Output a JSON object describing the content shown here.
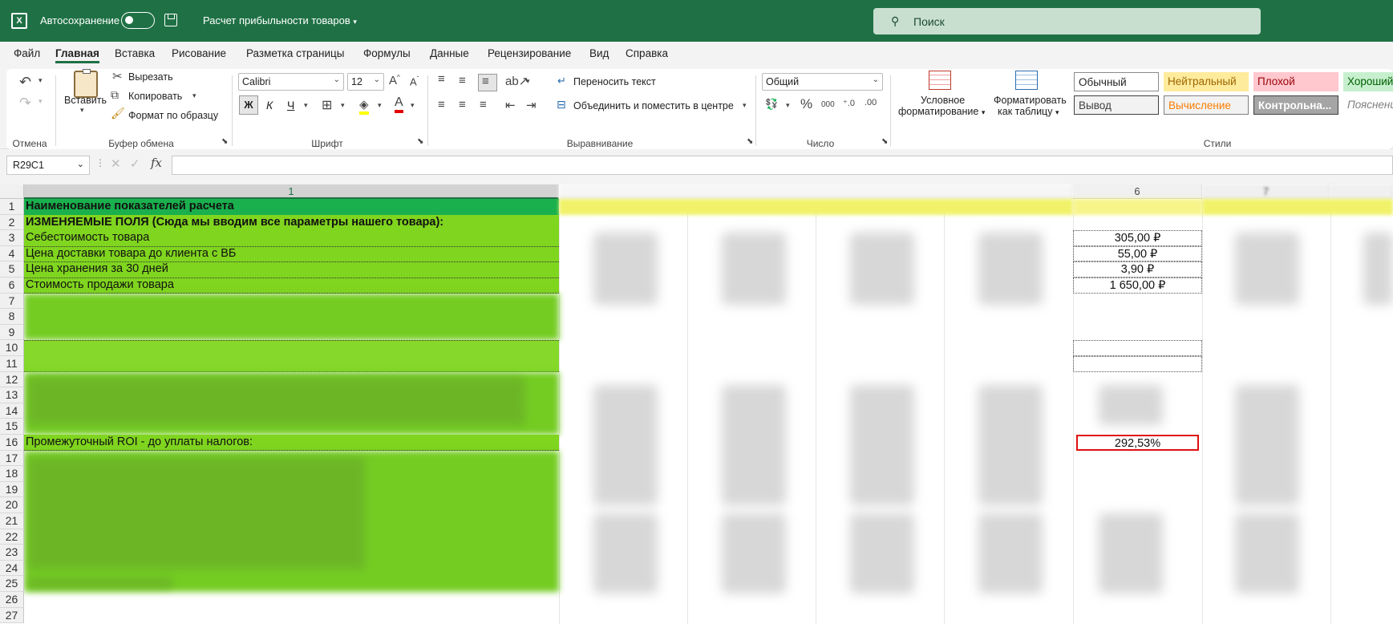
{
  "titlebar": {
    "autosave_label": "Автосохранение",
    "document_title": "Расчет прибыльности товаров",
    "search_placeholder": "Поиск"
  },
  "menu": [
    "Файл",
    "Главная",
    "Вставка",
    "Рисование",
    "Разметка страницы",
    "Формулы",
    "Данные",
    "Рецензирование",
    "Вид",
    "Справка"
  ],
  "ribbon": {
    "groups": {
      "undo": "Отмена",
      "clipboard": "Буфер обмена",
      "font": "Шрифт",
      "alignment": "Выравнивание",
      "number": "Число",
      "styles": "Стили"
    },
    "paste": "Вставить",
    "cut": "Вырезать",
    "copy": "Копировать",
    "format_painter": "Формат по образцу",
    "font_name": "Calibri",
    "font_size": "12",
    "bold": "Ж",
    "italic": "К",
    "underline": "Ч",
    "wrap_text": "Переносить текст",
    "merge_center": "Объединить и поместить в центре",
    "number_format": "Общий",
    "conditional_formatting": [
      "Условное",
      "форматирование"
    ],
    "format_as_table": [
      "Форматировать",
      "как таблицу"
    ],
    "cell_styles": [
      {
        "label": "Обычный",
        "bg": "#ffffff",
        "color": "#222222",
        "border": "#8a8a8a"
      },
      {
        "label": "Нейтральный",
        "bg": "#ffeb9c",
        "color": "#9c6500",
        "border": ""
      },
      {
        "label": "Плохой",
        "bg": "#ffc7ce",
        "color": "#9c0006",
        "border": ""
      },
      {
        "label": "Хороший",
        "bg": "#c6efce",
        "color": "#006100",
        "border": ""
      },
      {
        "label": "Вывод",
        "bg": "#f2f2f2",
        "color": "#3f3f3f",
        "border": "#3f3f3f"
      },
      {
        "label": "Вычисление",
        "bg": "#f2f2f2",
        "color": "#fa7d00",
        "border": "#7f7f7f"
      },
      {
        "label": "Контрольна...",
        "bg": "#a5a5a5",
        "color": "#ffffff",
        "border": "#3f3f3f"
      },
      {
        "label": "Пояснени",
        "bg": "#ffffff",
        "color": "#7f7f7f",
        "border": ""
      }
    ]
  },
  "formula_bar": {
    "name_box": "R29C1",
    "fx": "fx",
    "formula": ""
  },
  "columns": {
    "c1": "1",
    "c6": "6",
    "c7": "7"
  },
  "rows": {
    "r1": "Наименование показателей расчета",
    "r2": "ИЗМЕНЯЕМЫЕ ПОЛЯ (Сюда мы вводим все параметры нашего товара):",
    "r3": "Себестоимость товара",
    "r4": "Цена доставки товара до клиента с ВБ",
    "r5": "Цена хранения за 30 дней",
    "r6": "Стоимость продажи товара",
    "r16": "Промежуточный ROI - до уплаты налогов:"
  },
  "values": {
    "r3": "305,00 ₽",
    "r4": "55,00 ₽",
    "r5": "3,90 ₽",
    "r6": "1 650,00 ₽",
    "r16": "292,53%"
  },
  "row_numbers": [
    "1",
    "2",
    "3",
    "4",
    "5",
    "6",
    "7",
    "8",
    "9",
    "10",
    "11",
    "12",
    "13",
    "14",
    "15",
    "16",
    "17",
    "18",
    "19",
    "20",
    "21",
    "22",
    "23",
    "24",
    "25",
    "26",
    "27"
  ],
  "colors": {
    "accent": "#1f7145",
    "fill_green": "#80d51f",
    "fill_yellow": "#f1f26a",
    "highlight_red": "#e01010"
  }
}
